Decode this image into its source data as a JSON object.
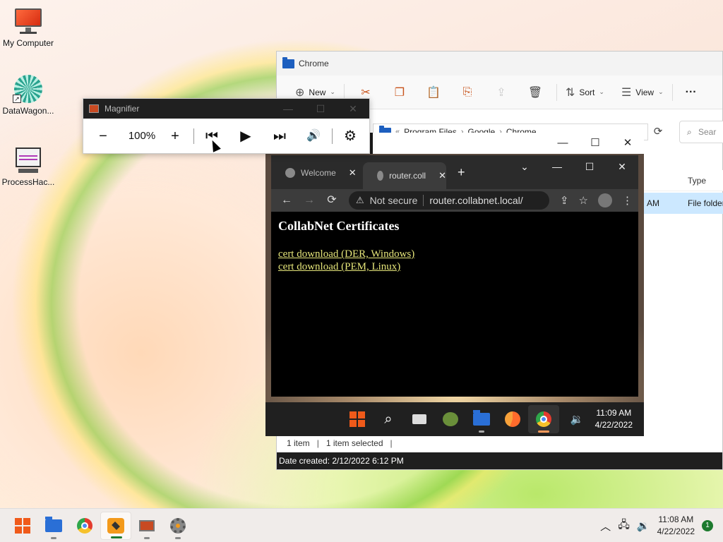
{
  "desktop": {
    "icons": [
      {
        "label": "My Computer",
        "icon": "monitor-icon"
      },
      {
        "label": "DataWagon...",
        "icon": "datawagon-icon"
      },
      {
        "label": "ProcessHac...",
        "icon": "process-hacker-icon"
      }
    ]
  },
  "explorer": {
    "title": "Chrome",
    "commands": {
      "new": "New",
      "sort": "Sort",
      "view": "View",
      "more": "···"
    },
    "address": {
      "parts": [
        "Program Files",
        "Google",
        "Chrome"
      ],
      "separator": "›",
      "overflow": "«"
    },
    "search_placeholder": "Sear",
    "column_type": "Type",
    "row": {
      "time": "AM",
      "type": "File folder"
    },
    "status": {
      "count": "1 item",
      "selected": "1 item selected"
    },
    "details": "Date created: 2/12/2022 6:12 PM"
  },
  "magnifier": {
    "title": "Magnifier",
    "zoom": "100%",
    "buttons": {
      "minus": "−",
      "plus": "+",
      "prev": "⏮",
      "play": "▶",
      "next": "⏭",
      "read": "🔊",
      "settings": "⚙"
    }
  },
  "vm": {
    "window_controls": {
      "minimize": "—",
      "maximize": "☐",
      "close": "✕"
    },
    "taskbar_clock": {
      "time": "11:09 AM",
      "date": "4/22/2022"
    }
  },
  "chrome": {
    "tabs": [
      {
        "title": "Welcome",
        "active": false
      },
      {
        "title": "router.coll",
        "active": true
      }
    ],
    "security": "Not secure",
    "url": "router.collabnet.local/",
    "page": {
      "heading": "CollabNet Certificates",
      "links": [
        "cert download (DER, Windows)",
        "cert download (PEM, Linux)"
      ]
    }
  },
  "taskbar": {
    "clock": {
      "time": "11:08 AM",
      "date": "4/22/2022"
    },
    "notifications": "1"
  }
}
